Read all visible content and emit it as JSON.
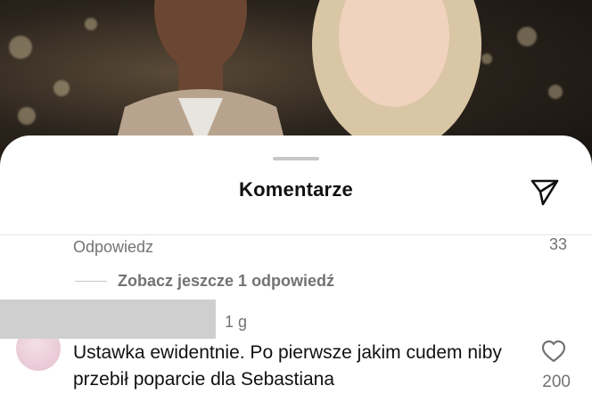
{
  "header": {
    "title": "Komentarze"
  },
  "thread": {
    "reply_label": "Odpowiedz",
    "parent_like_count": "33",
    "view_more_replies": "Zobacz jeszcze 1 odpowiedź"
  },
  "comment": {
    "time": "1 g",
    "text": "Ustawka ewidentnie. Po pierwsze jakim cudem niby przebił poparcie dla Sebastiana",
    "like_count": "200"
  },
  "icons": {
    "share": "paper-plane-icon",
    "like": "heart-icon"
  }
}
